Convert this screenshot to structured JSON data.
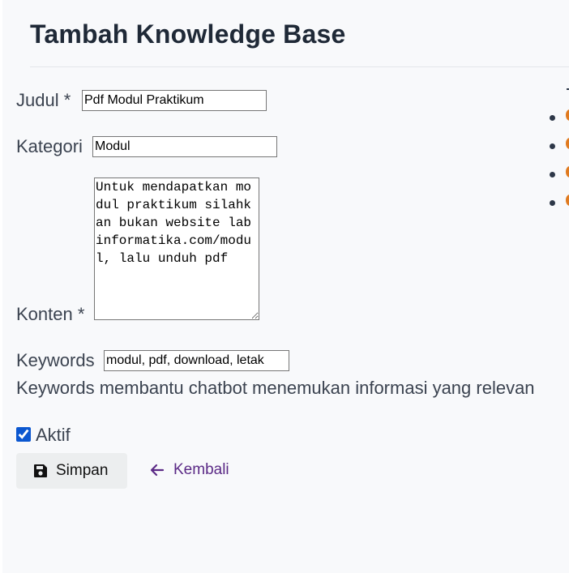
{
  "page": {
    "title": "Tambah Knowledge Base"
  },
  "form": {
    "judul": {
      "label": "Judul *",
      "value": "Pdf Modul Praktikum"
    },
    "kategori": {
      "label": "Kategori",
      "value": "Modul"
    },
    "konten": {
      "label": "Konten *",
      "value": "Untuk mendapatkan modul praktikum silahkan bukan website labinformatika.com/modul, lalu unduh pdf"
    },
    "keywords": {
      "label": "Keywords",
      "value": "modul, pdf, download, letak",
      "help": "Keywords membantu chatbot menemukan informasi yang relevan"
    },
    "aktif": {
      "label": "Aktif",
      "checked": true
    }
  },
  "actions": {
    "save_label": "Simpan",
    "save_icon": "save-icon",
    "back_label": "Kembali",
    "back_icon": "arrow-left-icon"
  },
  "colors": {
    "page_background": "#f8f9fb",
    "link": "#5b2a86",
    "button_background": "#eceeef",
    "checkbox_accent": "#0b57d0"
  }
}
